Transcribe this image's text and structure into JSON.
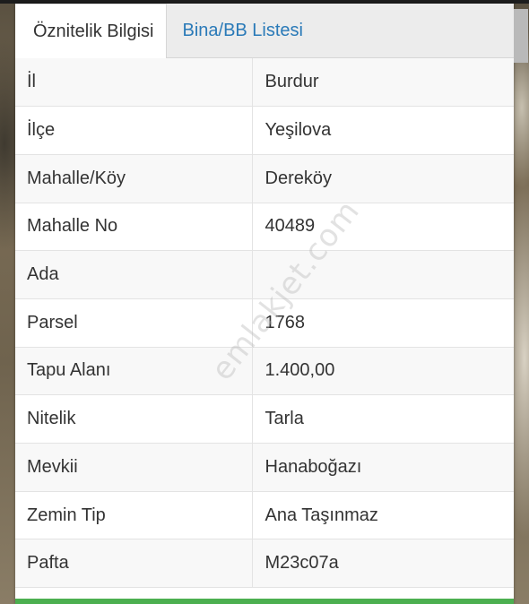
{
  "tabs": [
    {
      "label": "Öznitelik Bilgisi",
      "active": true
    },
    {
      "label": "Bina/BB Listesi",
      "active": false
    }
  ],
  "attributes": [
    {
      "key": "İl",
      "value": "Burdur"
    },
    {
      "key": "İlçe",
      "value": "Yeşilova"
    },
    {
      "key": "Mahalle/Köy",
      "value": "Dereköy"
    },
    {
      "key": "Mahalle No",
      "value": "40489"
    },
    {
      "key": "Ada",
      "value": ""
    },
    {
      "key": "Parsel",
      "value": "1768"
    },
    {
      "key": "Tapu Alanı",
      "value": "1.400,00"
    },
    {
      "key": "Nitelik",
      "value": "Tarla"
    },
    {
      "key": "Mevkii",
      "value": "Hanaboğazı"
    },
    {
      "key": "Zemin Tip",
      "value": "Ana Taşınmaz"
    },
    {
      "key": "Pafta",
      "value": "M23c07a"
    }
  ],
  "watermark": "emlakjet.com",
  "colors": {
    "tab_link": "#2a7ab8",
    "accent_bar": "#4caf50"
  }
}
